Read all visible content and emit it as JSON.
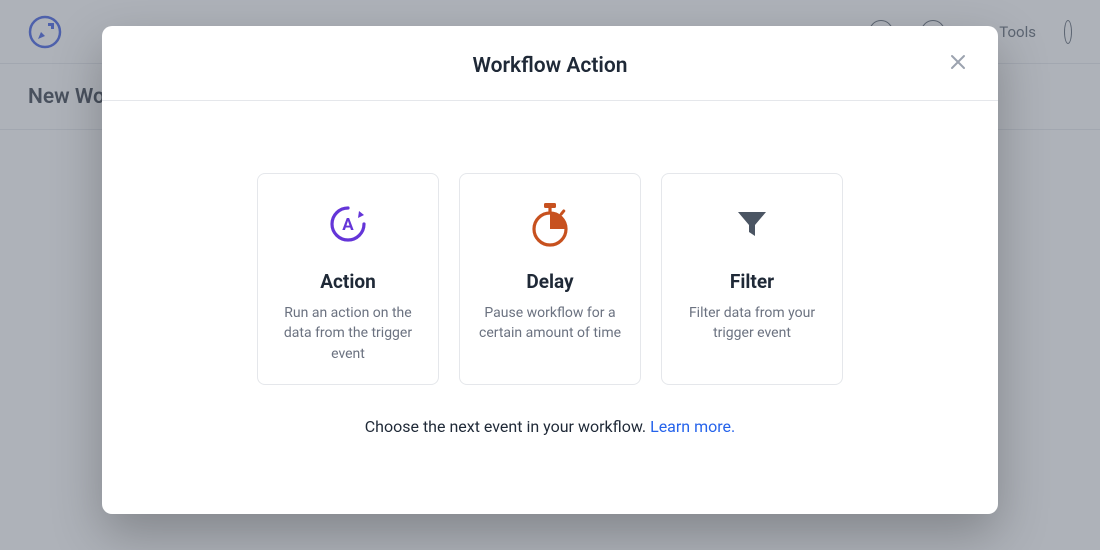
{
  "header": {
    "tools_label": "Tools"
  },
  "subheader": {
    "title": "New Workflow"
  },
  "modal": {
    "title": "Workflow Action",
    "footer_text": "Choose the next event in your workflow. ",
    "learn_more": "Learn more.",
    "cards": [
      {
        "title": "Action",
        "desc": "Run an action on the data from the trigger event"
      },
      {
        "title": "Delay",
        "desc": "Pause workflow for a certain amount of time"
      },
      {
        "title": "Filter",
        "desc": "Filter data from your trigger event"
      }
    ]
  },
  "colors": {
    "brand_blue": "#2B4CE0",
    "action_purple": "#6435D8",
    "delay_orange": "#C7511F",
    "filter_gray": "#4B5563"
  }
}
